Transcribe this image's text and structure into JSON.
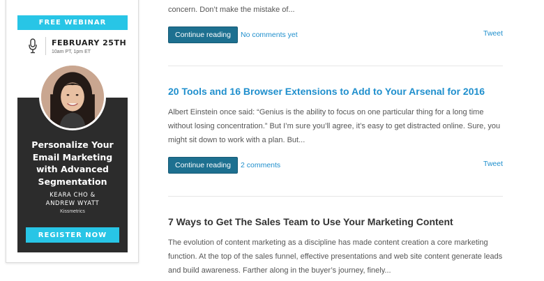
{
  "sidebar_ad": {
    "band_label": "FREE WEBINAR",
    "date": "FEBRUARY 25TH",
    "time": "10am PT, 1pm ET",
    "headline_lines": [
      "Personalize Your",
      "Email Marketing",
      "with Advanced",
      "Segmentation"
    ],
    "speaker_lines": [
      "KEARA CHO &",
      "ANDREW WYATT"
    ],
    "company": "Kissmetrics",
    "register_label": "REGISTER NOW",
    "icon": "microphone-icon",
    "colors": {
      "accent": "#28c5e6",
      "dark_panel": "#2c2c2c"
    }
  },
  "posts": [
    {
      "excerpt_lines": [
        "concern. Don’t make the mistake of..."
      ],
      "continue_label": "Continue reading",
      "comments_label": "No comments yet",
      "tweet_label": "Tweet"
    },
    {
      "title": "20 Tools and 16 Browser Extensions to Add to Your Arsenal for 2016",
      "excerpt_lines": [
        "Albert Einstein once said: “Genius is the ability to focus on one particular thing for a long time",
        "without losing concentration.” But I’m sure you’ll agree, it’s easy to get distracted online. Sure, you",
        "might sit down to work with a plan. But..."
      ],
      "continue_label": "Continue reading",
      "comments_label": "2 comments",
      "tweet_label": "Tweet"
    },
    {
      "title": "7 Ways to Get The Sales Team to Use Your Marketing Content",
      "excerpt_lines": [
        "The evolution of content marketing as a discipline has made content creation a core marketing",
        "function. At the top of the sales funnel, effective presentations and web site content generate leads",
        "and build awareness. Farther along in the buyer’s journey, finely..."
      ]
    }
  ],
  "colors": {
    "link": "#1f8fcd",
    "button": "#1d7090",
    "text": "#555555"
  }
}
